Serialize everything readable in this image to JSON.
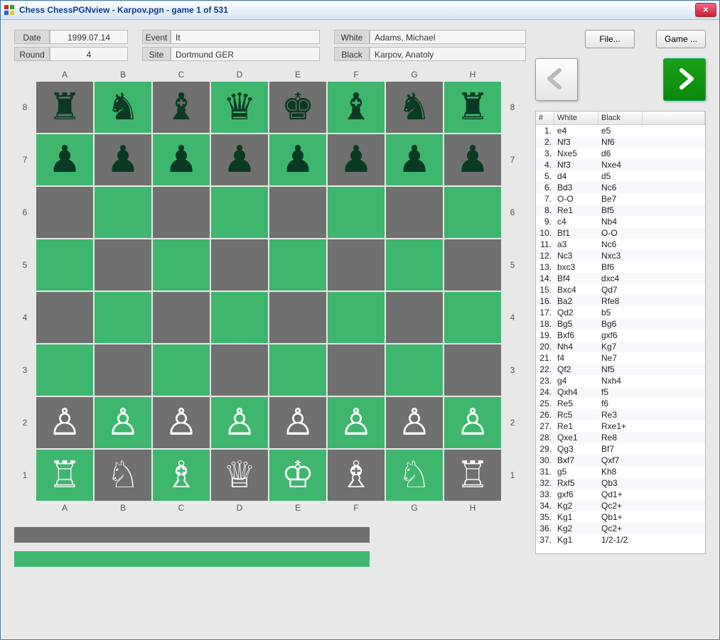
{
  "window": {
    "title": "Chess ChessPGNview - Karpov.pgn - game 1 of 531"
  },
  "meta": {
    "date_label": "Date",
    "date": "1999.07.14",
    "round_label": "Round",
    "round": "4",
    "event_label": "Event",
    "event": "It",
    "site_label": "Site",
    "site": "Dortmund GER",
    "white_label": "White",
    "white": "Adams, Michael",
    "black_label": "Black",
    "black": "Karpov, Anatoly"
  },
  "buttons": {
    "file": "File...",
    "game": "Game ..."
  },
  "board": {
    "files": [
      "A",
      "B",
      "C",
      "D",
      "E",
      "F",
      "G",
      "H"
    ],
    "ranks": [
      "8",
      "7",
      "6",
      "5",
      "4",
      "3",
      "2",
      "1"
    ],
    "position": [
      [
        "br",
        "bn",
        "bb",
        "bq",
        "bk",
        "bb",
        "bn",
        "br"
      ],
      [
        "bp",
        "bp",
        "bp",
        "bp",
        "bp",
        "bp",
        "bp",
        "bp"
      ],
      [
        "",
        "",
        "",
        "",
        "",
        "",
        "",
        ""
      ],
      [
        "",
        "",
        "",
        "",
        "",
        "",
        "",
        ""
      ],
      [
        "",
        "",
        "",
        "",
        "",
        "",
        "",
        ""
      ],
      [
        "",
        "",
        "",
        "",
        "",
        "",
        "",
        ""
      ],
      [
        "wp",
        "wp",
        "wp",
        "wp",
        "wp",
        "wp",
        "wp",
        "wp"
      ],
      [
        "wr",
        "wn",
        "wb",
        "wq",
        "wk",
        "wb",
        "wn",
        "wr"
      ]
    ]
  },
  "moves": {
    "headers": {
      "num": "#",
      "white": "White",
      "black": "Black"
    },
    "list": [
      {
        "n": "1.",
        "w": "e4",
        "b": "e5"
      },
      {
        "n": "2.",
        "w": "Nf3",
        "b": "Nf6"
      },
      {
        "n": "3.",
        "w": "Nxe5",
        "b": "d6"
      },
      {
        "n": "4.",
        "w": "Nf3",
        "b": "Nxe4"
      },
      {
        "n": "5.",
        "w": "d4",
        "b": "d5"
      },
      {
        "n": "6.",
        "w": "Bd3",
        "b": "Nc6"
      },
      {
        "n": "7.",
        "w": "O-O",
        "b": "Be7"
      },
      {
        "n": "8.",
        "w": "Re1",
        "b": "Bf5"
      },
      {
        "n": "9.",
        "w": "c4",
        "b": "Nb4"
      },
      {
        "n": "10.",
        "w": "Bf1",
        "b": "O-O"
      },
      {
        "n": "11.",
        "w": "a3",
        "b": "Nc6"
      },
      {
        "n": "12.",
        "w": "Nc3",
        "b": "Nxc3"
      },
      {
        "n": "13.",
        "w": "bxc3",
        "b": "Bf6"
      },
      {
        "n": "14.",
        "w": "Bf4",
        "b": "dxc4"
      },
      {
        "n": "15.",
        "w": "Bxc4",
        "b": "Qd7"
      },
      {
        "n": "16.",
        "w": "Ba2",
        "b": "Rfe8"
      },
      {
        "n": "17.",
        "w": "Qd2",
        "b": "b5"
      },
      {
        "n": "18.",
        "w": "Bg5",
        "b": "Bg6"
      },
      {
        "n": "19.",
        "w": "Bxf6",
        "b": "gxf6"
      },
      {
        "n": "20.",
        "w": "Nh4",
        "b": "Kg7"
      },
      {
        "n": "21.",
        "w": "f4",
        "b": "Ne7"
      },
      {
        "n": "22.",
        "w": "Qf2",
        "b": "Nf5"
      },
      {
        "n": "23.",
        "w": "g4",
        "b": "Nxh4"
      },
      {
        "n": "24.",
        "w": "Qxh4",
        "b": "f5"
      },
      {
        "n": "25.",
        "w": "Re5",
        "b": "f6"
      },
      {
        "n": "26.",
        "w": "Rc5",
        "b": "Re3"
      },
      {
        "n": "27.",
        "w": "Re1",
        "b": "Rxe1+"
      },
      {
        "n": "28.",
        "w": "Qxe1",
        "b": "Re8"
      },
      {
        "n": "29.",
        "w": "Qg3",
        "b": "Bf7"
      },
      {
        "n": "30.",
        "w": "Bxf7",
        "b": "Qxf7"
      },
      {
        "n": "31.",
        "w": "g5",
        "b": "Kh8"
      },
      {
        "n": "32.",
        "w": "Rxf5",
        "b": "Qb3"
      },
      {
        "n": "33.",
        "w": "gxf6",
        "b": "Qd1+"
      },
      {
        "n": "34.",
        "w": "Kg2",
        "b": "Qc2+"
      },
      {
        "n": "35.",
        "w": "Kg1",
        "b": "Qb1+"
      },
      {
        "n": "36.",
        "w": "Kg2",
        "b": "Qc2+"
      },
      {
        "n": "37.",
        "w": "Kg1",
        "b": "1/2-1/2"
      }
    ]
  }
}
